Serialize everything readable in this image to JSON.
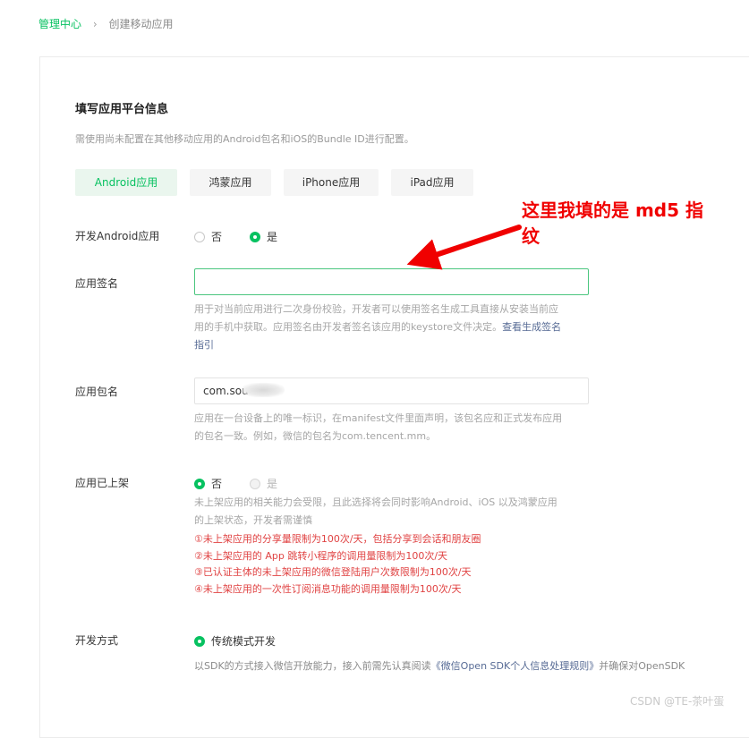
{
  "breadcrumb": {
    "root": "管理中心",
    "separator": "›",
    "current": "创建移动应用"
  },
  "section": {
    "title": "填写应用平台信息",
    "description": "需使用尚未配置在其他移动应用的Android包名和iOS的Bundle ID进行配置。"
  },
  "platform_tabs": [
    {
      "label": "Android应用",
      "active": true
    },
    {
      "label": "鸿蒙应用",
      "active": false
    },
    {
      "label": "iPhone应用",
      "active": false
    },
    {
      "label": "iPad应用",
      "active": false
    }
  ],
  "develop_android": {
    "label": "开发Android应用",
    "options": [
      {
        "label": "否",
        "checked": false
      },
      {
        "label": "是",
        "checked": true
      }
    ]
  },
  "app_signature": {
    "label": "应用签名",
    "value": "",
    "help_line1": "用于对当前应用进行二次身份校验，开发者可以使用签名生成工具直接从安装当前应",
    "help_line2": "用的手机中获取。应用签名由开发者签名该应用的keystore文件决定。",
    "help_link_part1": "查看生成签名",
    "help_link_part2": "指引"
  },
  "package_name": {
    "label": "应用包名",
    "value": "com.sou",
    "help_line1": "应用在一台设备上的唯一标识，在manifest文件里面声明，该包名应和正式发布应用",
    "help_line2": "的包名一致。例如，微信的包名为com.tencent.mm。"
  },
  "listed": {
    "label": "应用已上架",
    "options": [
      {
        "label": "否",
        "checked": true
      },
      {
        "label": "是",
        "checked": false,
        "disabled": true
      }
    ],
    "help_line1": "未上架应用的相关能力会受限，且此选择将会同时影响Android、iOS 以及鸿蒙应用",
    "help_line2": "的上架状态，开发者需谨慎",
    "warnings": [
      "①未上架应用的分享量限制为100次/天，包括分享到会话和朋友圈",
      "②未上架应用的 App 跳转小程序的调用量限制为100次/天",
      "③已认证主体的未上架应用的微信登陆用户次数限制为100次/天",
      "④未上架应用的一次性订阅消息功能的调用量限制为100次/天"
    ]
  },
  "dev_mode": {
    "label": "开发方式",
    "option": "传统模式开发",
    "help": "以SDK的方式接入微信开放能力，接入前需先认真阅读《微信Open SDK个人信息处理规则》并确保对OpenSDK",
    "help_prefix": "以SDK的方式接入微信开放能力，接入前需先认真阅读",
    "help_link": "《微信Open SDK个人信息处理规则》",
    "help_suffix": "并确保对OpenSDK"
  },
  "annotation": {
    "line1": "这里我填的是 md5 指",
    "line2": "纹",
    "color": "#f00000"
  },
  "watermark": "CSDN @TE-茶叶蛋",
  "colors": {
    "accent": "#07c160",
    "warning": "#e04343",
    "link": "#576b95"
  }
}
